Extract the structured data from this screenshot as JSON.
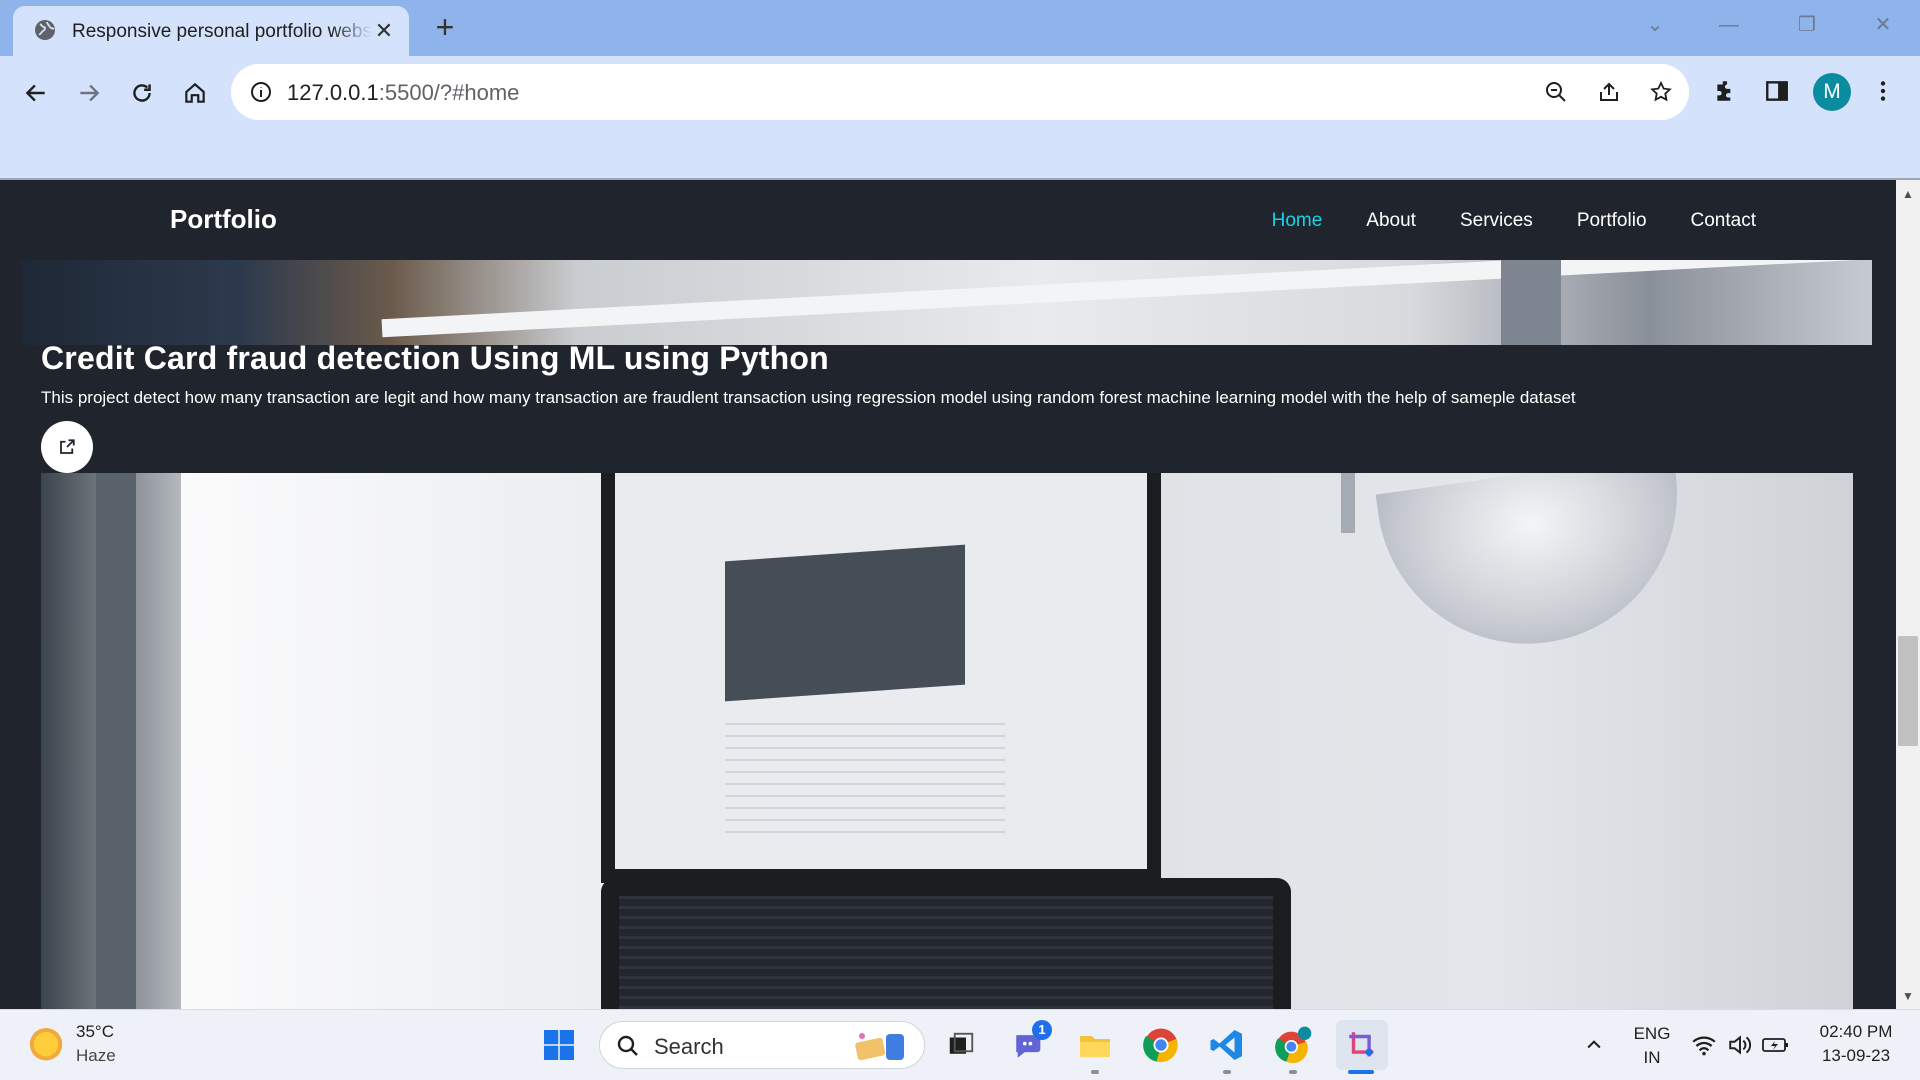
{
  "browser": {
    "tab_title": "Responsive personal portfolio website",
    "tab_close": "✕",
    "new_tab": "+",
    "url_host": "127.0.0.1",
    "url_rest": ":5500/?#home",
    "avatar_letter": "M",
    "window_controls": [
      "⌄",
      "—",
      "❐",
      "✕"
    ]
  },
  "site": {
    "logo": "Portfolio",
    "nav": [
      {
        "label": "Home",
        "active": true
      },
      {
        "label": "About",
        "active": false
      },
      {
        "label": "Services",
        "active": false
      },
      {
        "label": "Portfolio",
        "active": false
      },
      {
        "label": "Contact",
        "active": false
      }
    ],
    "accent_color": "#16d3e8",
    "background_color": "#1f242d"
  },
  "project": {
    "title": "Credit Card fraud detection Using ML using Python",
    "description": "This project detect how many transaction are legit and how many transaction are fraudlent transaction using regression model using random forest machine learning model with the help of sameple dataset",
    "link_icon": "external-link-icon"
  },
  "taskbar": {
    "temperature": "35°C",
    "weather": "Haze",
    "search_label": "Search",
    "chat_badge": "1",
    "lang_top": "ENG",
    "lang_bottom": "IN",
    "time": "02:40 PM",
    "date": "13-09-23"
  }
}
